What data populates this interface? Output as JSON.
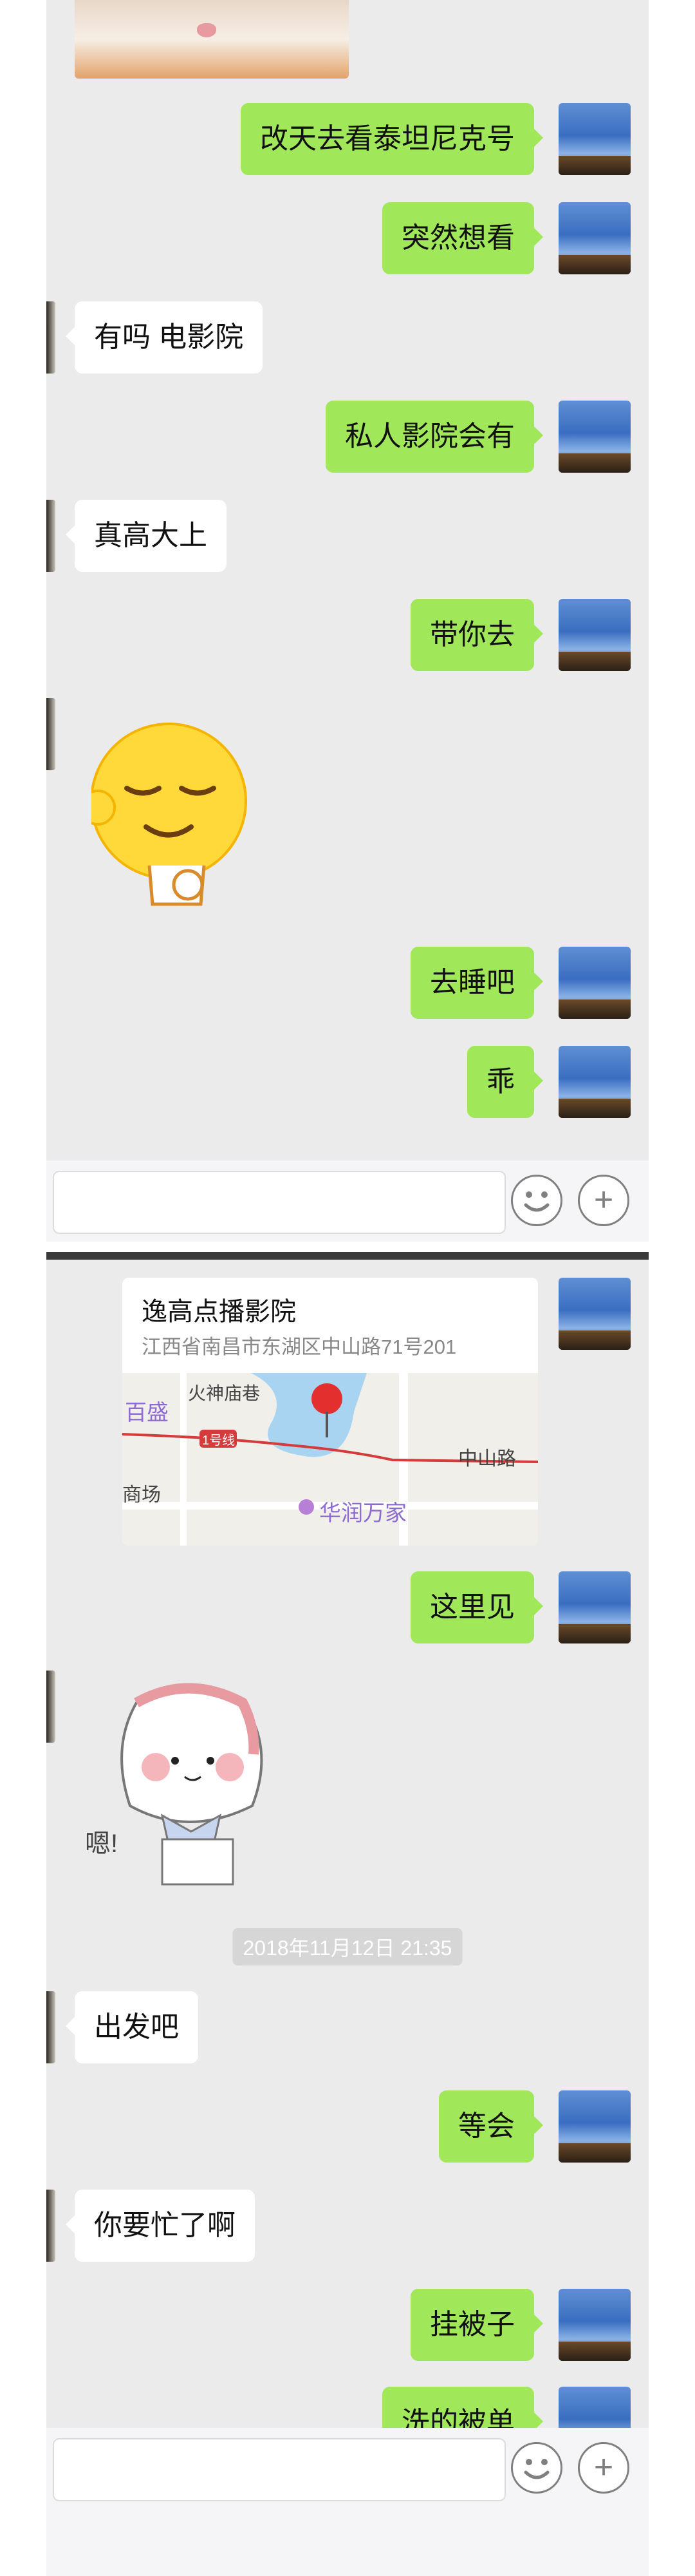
{
  "screen1": {
    "messages": [
      {
        "side": "me",
        "text": "改天去看泰坦尼克号"
      },
      {
        "side": "me",
        "text": "突然想看"
      },
      {
        "side": "other",
        "text": "有吗 电影院"
      },
      {
        "side": "me",
        "text": "私人影院会有"
      },
      {
        "side": "other",
        "text": "真高大上"
      },
      {
        "side": "me",
        "text": "带你去"
      },
      {
        "side": "other",
        "sticker": "relieved-emoji-sticker"
      },
      {
        "side": "me",
        "text": "去睡吧"
      },
      {
        "side": "me",
        "text": "乖"
      }
    ]
  },
  "screen2": {
    "location": {
      "name": "逸高点播影院",
      "address": "江西省南昌市东湖区中山路71号201",
      "map_labels": {
        "baisheng": "百盛",
        "shenmiao": "火神庙巷",
        "line1": "1号线",
        "zhongshan": "中山路",
        "shangchang": "商场",
        "huarun": "华润万家"
      }
    },
    "messages": [
      {
        "side": "me",
        "text": "这里见"
      },
      {
        "side": "other",
        "sticker": "cat-girl-sticker",
        "sticker_text": "嗯!"
      },
      {
        "type": "time",
        "text": "2018年11月12日 21:35"
      },
      {
        "side": "other",
        "text": "出发吧"
      },
      {
        "side": "me",
        "text": "等会"
      },
      {
        "side": "other",
        "text": "你要忙了啊"
      },
      {
        "side": "me",
        "text": "挂被子"
      },
      {
        "side": "me",
        "text": "洗的被单"
      }
    ]
  },
  "icons": {
    "emoji": "smiley-icon",
    "plus": "plus-icon"
  },
  "colors": {
    "my_bubble": "#a0e75a",
    "other_bubble": "#ffffff",
    "chat_bg": "#ebebeb"
  }
}
